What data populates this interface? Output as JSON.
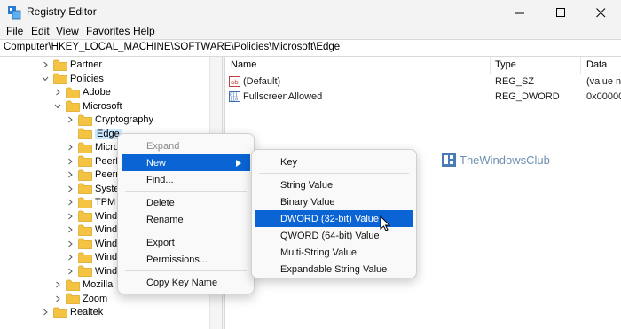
{
  "window": {
    "title": "Registry Editor",
    "icons": {
      "app": "registry-icon",
      "minimize": "minimize-icon",
      "maximize": "maximize-icon",
      "close": "close-icon"
    }
  },
  "menubar": [
    "File",
    "Edit",
    "View",
    "Favorites",
    "Help"
  ],
  "address": "Computer\\HKEY_LOCAL_MACHINE\\SOFTWARE\\Policies\\Microsoft\\Edge",
  "tree": [
    {
      "label": "Partner",
      "expanded": false
    },
    {
      "label": "Policies",
      "expanded": true
    },
    {
      "label": "Adobe",
      "expanded": false
    },
    {
      "label": "Microsoft",
      "expanded": true
    },
    {
      "label": "Cryptography",
      "expanded": false
    },
    {
      "label": "Edge",
      "selected": true
    },
    {
      "label": "Micro",
      "expanded": false
    },
    {
      "label": "PeerD",
      "expanded": false
    },
    {
      "label": "Peern",
      "expanded": false
    },
    {
      "label": "Syster",
      "expanded": false
    },
    {
      "label": "TPM",
      "expanded": false
    },
    {
      "label": "Windo",
      "expanded": false
    },
    {
      "label": "Windo",
      "expanded": false
    },
    {
      "label": "Windo",
      "expanded": false
    },
    {
      "label": "Windo",
      "expanded": false
    },
    {
      "label": "Windo",
      "expanded": false
    },
    {
      "label": "Mozilla",
      "expanded": false
    },
    {
      "label": "Zoom",
      "expanded": false
    },
    {
      "label": "Realtek",
      "expanded": false
    }
  ],
  "list": {
    "columns": [
      "Name",
      "Type",
      "Data"
    ],
    "rows": [
      {
        "icon": "string-value-icon",
        "name": "(Default)",
        "type": "REG_SZ",
        "data": "(value n"
      },
      {
        "icon": "binary-value-icon",
        "name": "FullscreenAllowed",
        "type": "REG_DWORD",
        "data": "0x00000"
      }
    ]
  },
  "watermark": "TheWindowsClub",
  "context_menu": {
    "items": [
      {
        "label": "Expand",
        "disabled": true
      },
      {
        "label": "New",
        "active": true,
        "submenu": true
      },
      {
        "label": "Find..."
      },
      {
        "separator": true
      },
      {
        "label": "Delete"
      },
      {
        "label": "Rename"
      },
      {
        "separator": true
      },
      {
        "label": "Export"
      },
      {
        "label": "Permissions..."
      },
      {
        "separator": true
      },
      {
        "label": "Copy Key Name"
      }
    ]
  },
  "submenu": {
    "items": [
      {
        "label": "Key"
      },
      {
        "separator": true
      },
      {
        "label": "String Value"
      },
      {
        "label": "Binary Value"
      },
      {
        "label": "DWORD (32-bit) Value",
        "active": true
      },
      {
        "label": "QWORD (64-bit) Value"
      },
      {
        "label": "Multi-String Value"
      },
      {
        "label": "Expandable String Value"
      }
    ]
  },
  "colors": {
    "accent": "#0a64d4",
    "folder": "#f5c342",
    "selection": "#cce8ff"
  }
}
